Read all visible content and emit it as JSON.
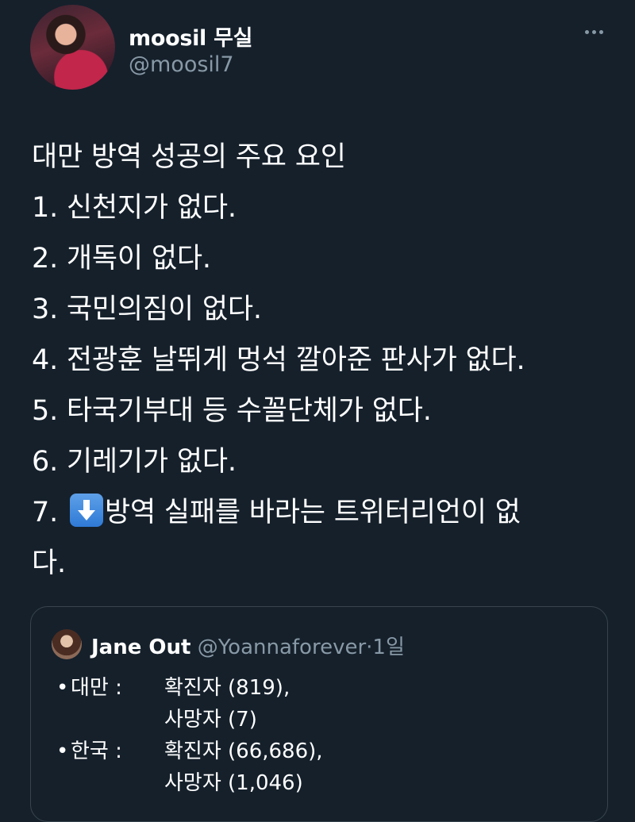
{
  "author": {
    "display_name": "moosil 무실",
    "handle": "@moosil7"
  },
  "tweet": {
    "lines": [
      "대만 방역 성공의 주요 요인",
      "1. 신천지가 없다.",
      "2. 개독이 없다.",
      "3. 국민의짐이 없다.",
      "4. 전광훈 날뛰게 멍석 깔아준 판사가 없다.",
      "5. 타국기부대 등 수꼴단체가 없다.",
      "6. 기레기가 없다."
    ],
    "line7_prefix": "7.",
    "line7_emoji": "down-arrow-emoji",
    "line7_rest": "방역 실패를 바라는 트위터리언이 없",
    "line8": "다."
  },
  "quoted": {
    "name": "Jane Out",
    "handle": "@Yoannaforever",
    "separator": "·",
    "time": "1일",
    "bullet": "•",
    "rows": [
      {
        "label": "대만 :",
        "value": "확진자 (819),"
      },
      {
        "label": "",
        "value": "사망자 (7)"
      },
      {
        "label": "한국 :",
        "value": "확진자 (66,686),"
      },
      {
        "label": "",
        "value": "사망자 (1,046)"
      }
    ]
  },
  "colors": {
    "background": "#15202b",
    "text": "#ffffff",
    "secondary": "#8899a6",
    "border": "#38444d"
  },
  "icons": {
    "more": "more-horizontal-icon"
  }
}
